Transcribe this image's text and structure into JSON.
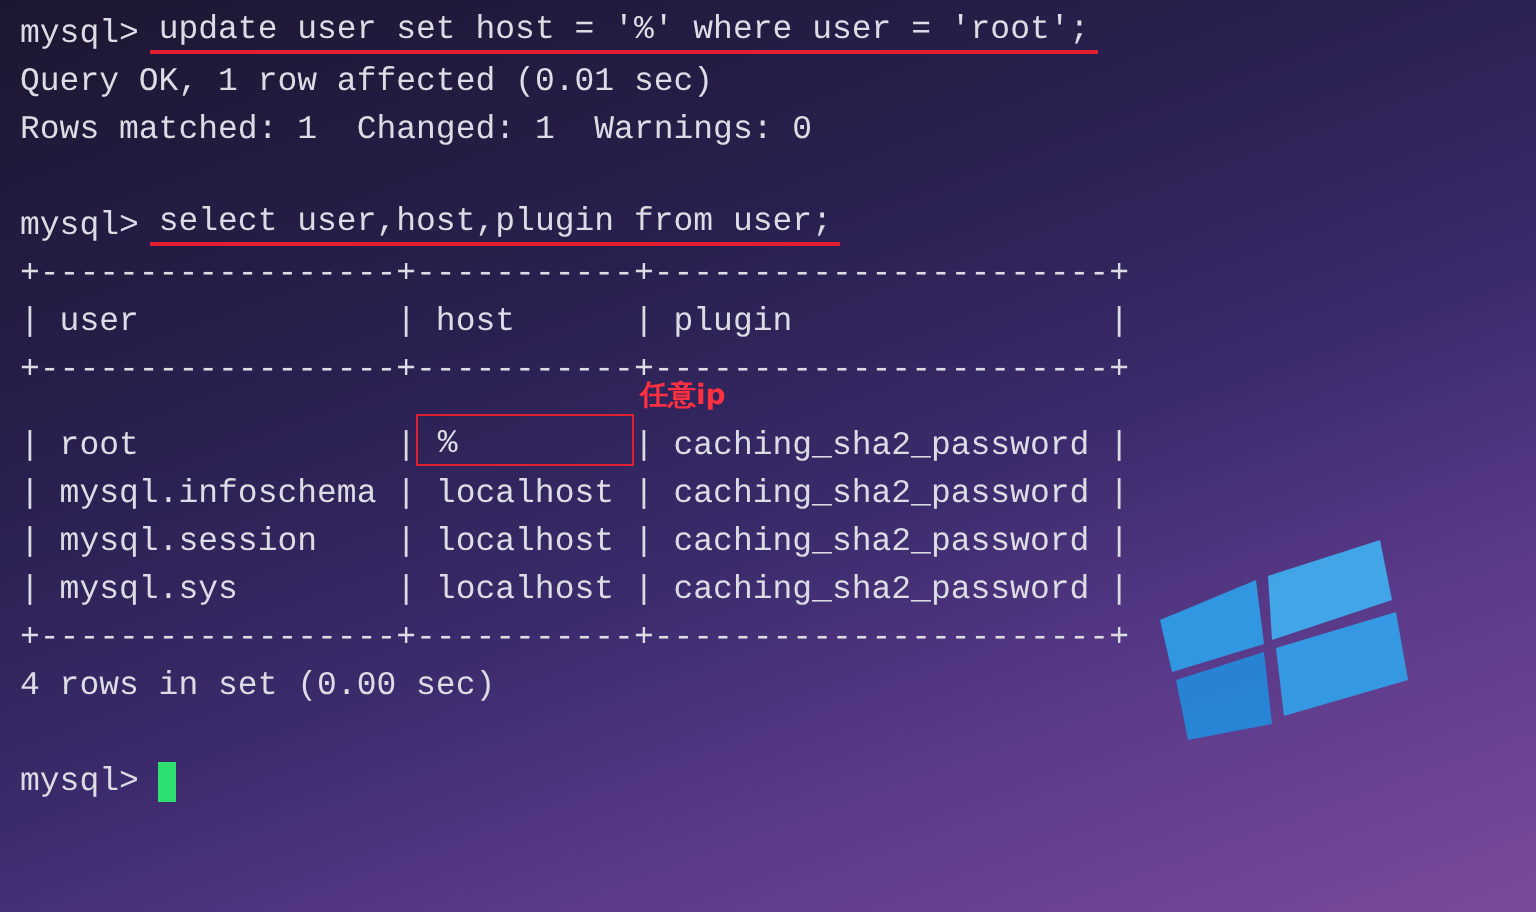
{
  "terminal": {
    "separator": "|",
    "lines": [
      {
        "kind": "command",
        "prompt": "mysql>",
        "command": "update user set host = '%' where user = 'root';",
        "underlined": true
      },
      {
        "kind": "output",
        "text": "Query OK, 1 row affected (0.01 sec)"
      },
      {
        "kind": "output",
        "text": "Rows matched: 1  Changed: 1  Warnings: 0"
      },
      {
        "kind": "blank"
      },
      {
        "kind": "command",
        "prompt": "mysql>",
        "command": "select user,host,plugin from user;",
        "underlined": true
      },
      {
        "kind": "output",
        "text": "+------------------+-----------+-----------------------+"
      },
      {
        "kind": "row",
        "cells": [
          {
            "text": "user",
            "boxed": false
          },
          {
            "text": "host",
            "boxed": false
          },
          {
            "text": "plugin",
            "boxed": false
          }
        ]
      },
      {
        "kind": "output",
        "text": "+------------------+-----------+-----------------------+"
      },
      {
        "kind": "row",
        "cells": [
          {
            "text": "root",
            "boxed": false
          },
          {
            "text": "%",
            "boxed": true,
            "note": "任意ip"
          },
          {
            "text": "caching_sha2_password",
            "boxed": false
          }
        ]
      },
      {
        "kind": "row",
        "cells": [
          {
            "text": "mysql.infoschema",
            "boxed": false
          },
          {
            "text": "localhost",
            "boxed": false
          },
          {
            "text": "caching_sha2_password",
            "boxed": false
          }
        ]
      },
      {
        "kind": "row",
        "cells": [
          {
            "text": "mysql.session",
            "boxed": false
          },
          {
            "text": "localhost",
            "boxed": false
          },
          {
            "text": "caching_sha2_password",
            "boxed": false
          }
        ]
      },
      {
        "kind": "row",
        "cells": [
          {
            "text": "mysql.sys",
            "boxed": false
          },
          {
            "text": "localhost",
            "boxed": false
          },
          {
            "text": "caching_sha2_password",
            "boxed": false
          }
        ]
      },
      {
        "kind": "output",
        "text": "+------------------+-----------+-----------------------+"
      },
      {
        "kind": "output",
        "text": "4 rows in set (0.00 sec)"
      },
      {
        "kind": "blank"
      },
      {
        "kind": "prompt",
        "prompt": "mysql>",
        "cursor": true
      }
    ]
  }
}
